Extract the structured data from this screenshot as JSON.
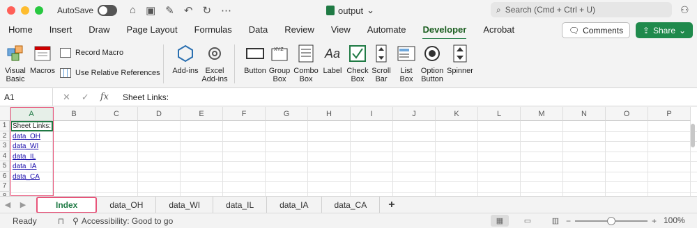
{
  "titlebar": {
    "autosave_label": "AutoSave",
    "doc_title": "output",
    "search_placeholder": "Search (Cmd + Ctrl + U)"
  },
  "tabs": [
    "Home",
    "Insert",
    "Draw",
    "Page Layout",
    "Formulas",
    "Data",
    "Review",
    "View",
    "Automate",
    "Developer",
    "Acrobat"
  ],
  "active_tab": "Developer",
  "header_buttons": {
    "comments": "Comments",
    "share": "Share"
  },
  "ribbon": {
    "visual_basic": "Visual Basic",
    "macros": "Macros",
    "record_macro": "Record Macro",
    "relative_refs": "Use Relative References",
    "addins": "Add-ins",
    "excel_addins": "Excel Add-ins",
    "button": "Button",
    "group_box": "Group Box",
    "combo_box": "Combo Box",
    "label": "Label",
    "check_box": "Check Box",
    "scroll_bar": "Scroll Bar",
    "list_box": "List Box",
    "option_button": "Option Button",
    "spinner": "Spinner"
  },
  "formula_bar": {
    "name_box": "A1",
    "fx": "fx",
    "value": "Sheet Links:"
  },
  "grid": {
    "columns": [
      "A",
      "B",
      "C",
      "D",
      "E",
      "F",
      "G",
      "H",
      "I",
      "J",
      "K",
      "L",
      "M",
      "N",
      "O",
      "P"
    ],
    "rows": [
      "1",
      "2",
      "3",
      "4",
      "5",
      "6",
      "7",
      "8"
    ],
    "cells": [
      {
        "row": 1,
        "text": "Sheet Links:",
        "link": false
      },
      {
        "row": 2,
        "text": "data_OH",
        "link": true
      },
      {
        "row": 3,
        "text": "data_WI",
        "link": true
      },
      {
        "row": 4,
        "text": "data_IL",
        "link": true
      },
      {
        "row": 5,
        "text": "data_IA",
        "link": true
      },
      {
        "row": 6,
        "text": "data_CA",
        "link": true
      }
    ]
  },
  "sheets": [
    "Index",
    "data_OH",
    "data_WI",
    "data_IL",
    "data_IA",
    "data_CA"
  ],
  "active_sheet": "Index",
  "status": {
    "ready": "Ready",
    "accessibility": "Accessibility: Good to go",
    "zoom": "100%",
    "zoom_level": 0.5
  },
  "colors": {
    "accent": "#1f7a44",
    "highlight": "#e8547a",
    "link": "#1a0dab"
  }
}
